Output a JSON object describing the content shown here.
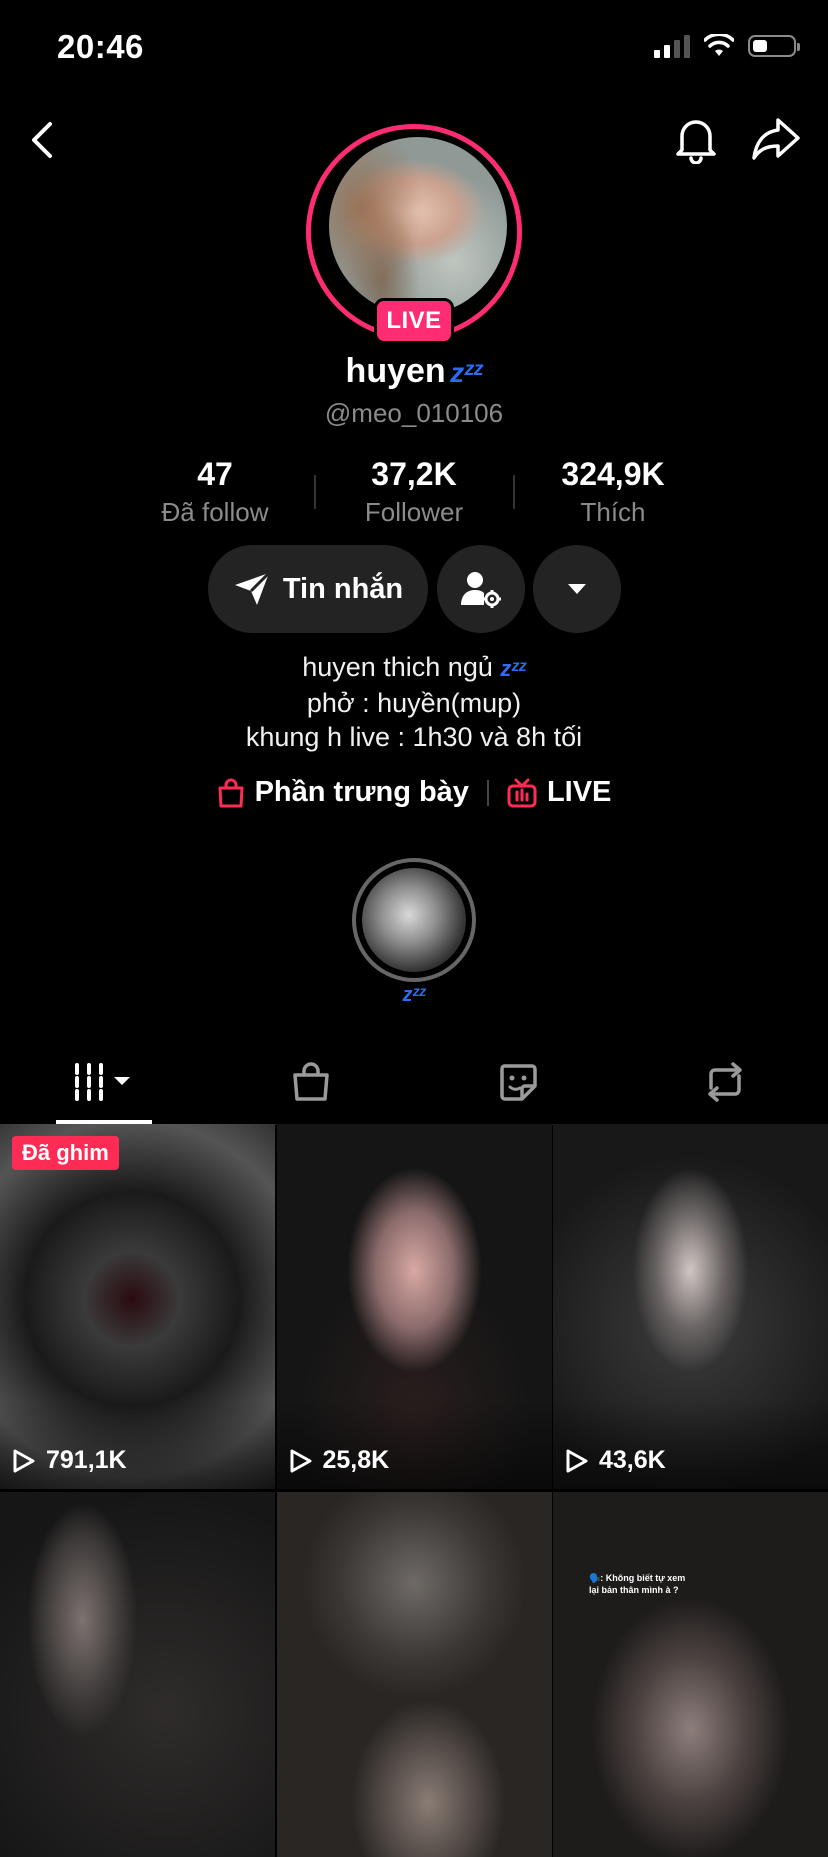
{
  "status_bar": {
    "time": "20:46"
  },
  "profile": {
    "name": "huyen",
    "name_emoji": "zᶻᶻ",
    "handle": "@meo_010106",
    "live_badge": "LIVE"
  },
  "stats": [
    {
      "value": "47",
      "label": "Đã follow"
    },
    {
      "value": "37,2K",
      "label": "Follower"
    },
    {
      "value": "324,9K",
      "label": "Thích"
    }
  ],
  "actions": {
    "message_label": "Tin nhắn"
  },
  "bio": {
    "line1": "huyen thich ngủ",
    "line1_emoji": "zᶻᶻ",
    "line2": "phở : huyền(mup)",
    "line3": "khung h live : 1h30 và 8h tối"
  },
  "links": {
    "showcase": "Phần trưng bày",
    "live": "LIVE"
  },
  "highlight": {
    "label": "zᶻᶻ"
  },
  "videos": [
    {
      "views": "791,1K",
      "pinned": "Đã ghim"
    },
    {
      "views": "25,8K"
    },
    {
      "views": "43,6K"
    },
    {
      "views": ""
    },
    {
      "views": ""
    },
    {
      "views": "",
      "caption_line1": "🗣️: Không biết tự xem",
      "caption_line2": "lại bản thân mình à ?"
    }
  ],
  "colors": {
    "accent": "#fe2c55",
    "live_ring": "#fe2c72",
    "emoji_blue": "#2b6cf6"
  },
  "icons": [
    "back-icon",
    "bell-icon",
    "share-icon",
    "send-icon",
    "person-settings-icon",
    "chevron-down-icon",
    "grid-icon",
    "bag-icon",
    "sticker-icon",
    "repost-icon",
    "shopping-bag-icon",
    "tv-icon",
    "play-icon"
  ]
}
